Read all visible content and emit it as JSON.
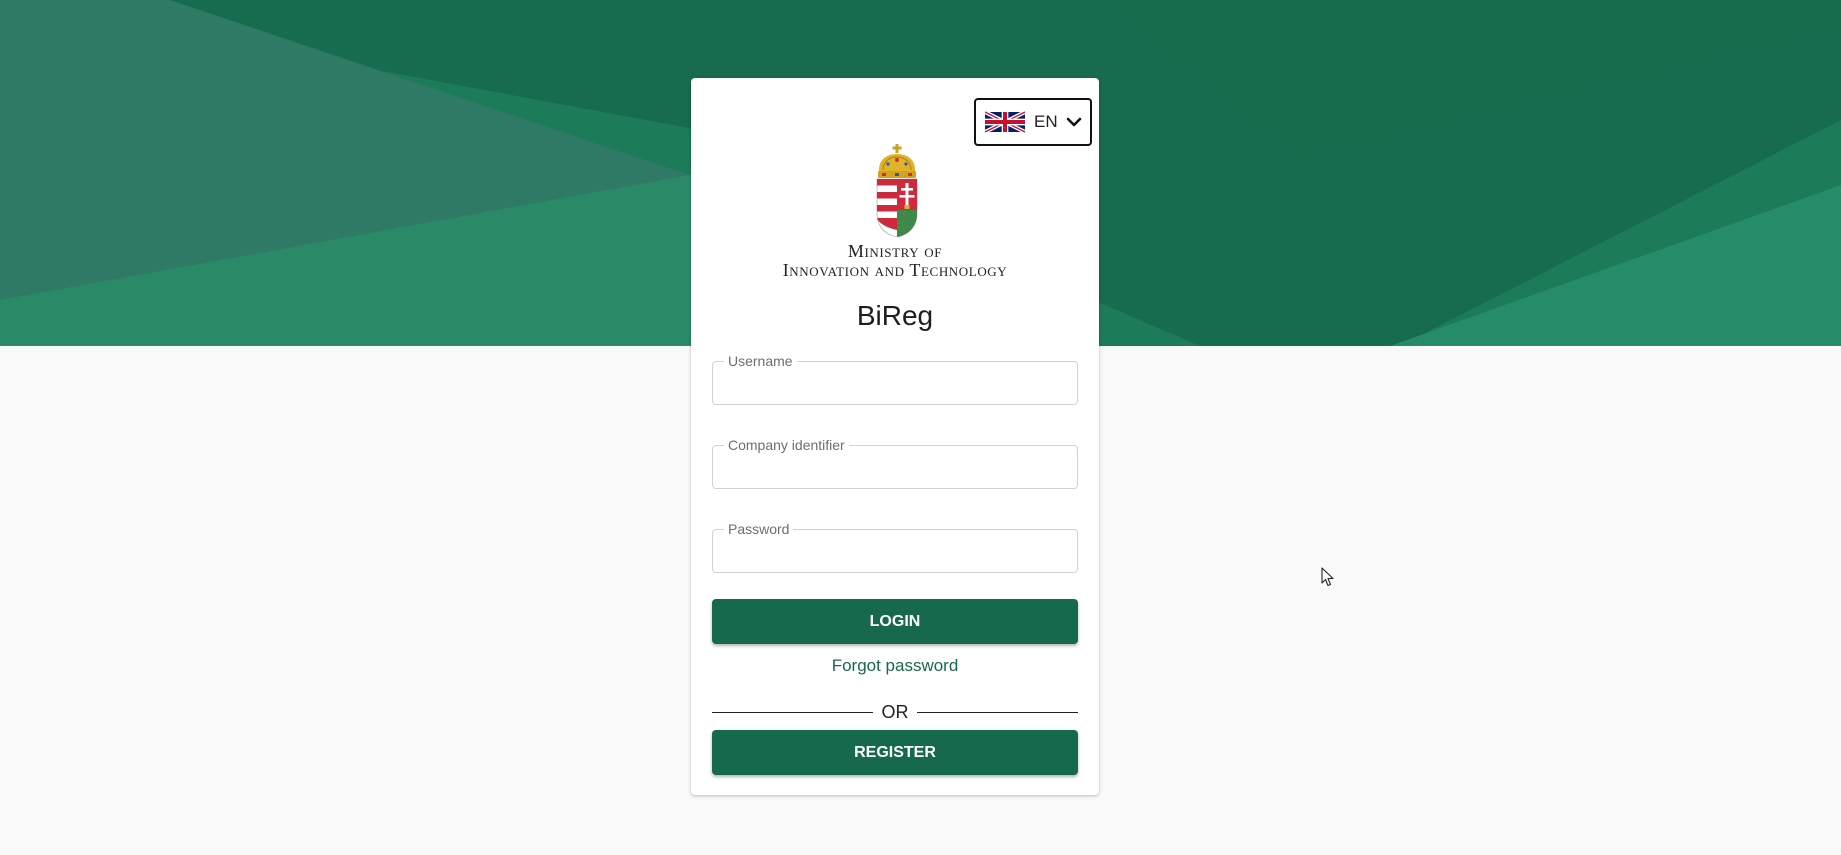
{
  "language": {
    "code": "EN",
    "flag_icon": "uk-flag-icon",
    "chevron_icon": "chevron-down-icon"
  },
  "ministry": {
    "line1": "Ministry of",
    "line2": "Innovation and Technology",
    "emblem_icon": "hungarian-coat-of-arms-icon"
  },
  "app_title": "BiReg",
  "form": {
    "username_label": "Username",
    "username_value": "",
    "company_label": "Company identifier",
    "company_value": "",
    "password_label": "Password",
    "password_value": "",
    "login_label": "LOGIN",
    "forgot_label": "Forgot password",
    "or_label": "OR",
    "register_label": "REGISTER"
  },
  "colors": {
    "brand_green": "#17694e",
    "banner_green": "#1b7a58",
    "page_background": "#f9f9f9"
  }
}
